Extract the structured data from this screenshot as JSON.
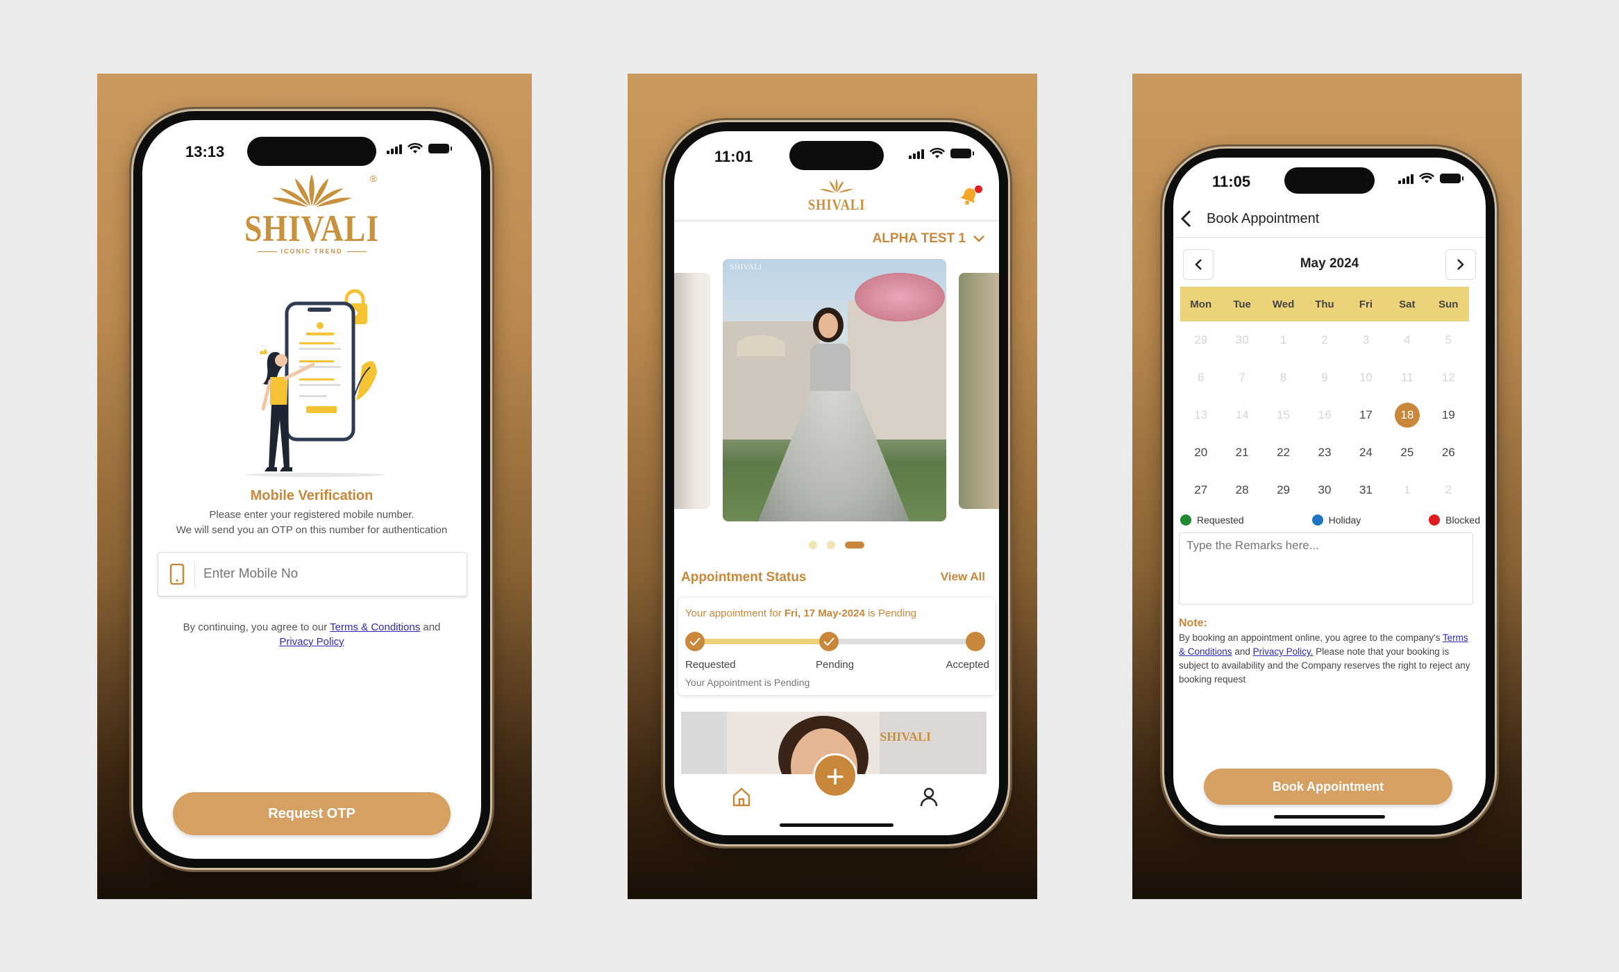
{
  "login": {
    "status_time": "13:13",
    "brand_name": "SHIVALI",
    "brand_tagline": "ICONIC TREND",
    "brand_registered": "®",
    "heading": "Mobile Verification",
    "subtitle_line1": "Please enter your registered mobile number.",
    "subtitle_line2": "We will send you an OTP on this number for authentication",
    "mobile_placeholder": "Enter Mobile No",
    "consent_prefix": "By continuing, you agree to our",
    "terms_link": "Terms & Conditions",
    "consent_and": "and",
    "privacy_link": "Privacy Policy",
    "request_button": "Request OTP"
  },
  "home": {
    "status_time": "11:01",
    "brand_name": "SHIVALI",
    "store_selector": "ALPHA TEST 1",
    "carousel_watermark": "SHIVALI",
    "carousel_total": 3,
    "carousel_active": 3,
    "appointment_heading": "Appointment Status",
    "view_all": "View All",
    "appointment_prefix": "Your appointment for",
    "appointment_date": "Fri, 17 May-2024",
    "appointment_suffix": "is Pending",
    "steps": [
      "Requested",
      "Pending",
      "Accepted"
    ],
    "status_note": "Your Appointment is Pending",
    "banner_watermark": "SHIVALI",
    "nav_add": "+"
  },
  "booking": {
    "status_time": "11:05",
    "title": "Book Appointment",
    "month": "May 2024",
    "weekdays": [
      "Mon",
      "Tue",
      "Wed",
      "Thu",
      "Fri",
      "Sat",
      "Sun"
    ],
    "days": [
      [
        "29",
        "30",
        "1",
        "2",
        "3",
        "4",
        "5"
      ],
      [
        "6",
        "7",
        "8",
        "9",
        "10",
        "11",
        "12"
      ],
      [
        "13",
        "14",
        "15",
        "16",
        "17",
        "18",
        "19"
      ],
      [
        "20",
        "21",
        "22",
        "23",
        "24",
        "25",
        "26"
      ],
      [
        "27",
        "28",
        "29",
        "30",
        "31",
        "1",
        "2"
      ]
    ],
    "selected_day": "18",
    "first_enabled_day": "17",
    "legend": [
      {
        "label": "Requested",
        "color": "#1f8a2e"
      },
      {
        "label": "Holiday",
        "color": "#1f74c4"
      },
      {
        "label": "Blocked",
        "color": "#e01b1b"
      }
    ],
    "remarks_placeholder": "Type the Remarks here...",
    "note_title": "Note:",
    "note_text_1": "By booking an appointment online, you agree to the company's",
    "terms_link": "Terms & Conditions",
    "note_and": "and",
    "privacy_link": "Privacy Policy.",
    "note_text_2": "Please note that your booking is subject to availability and the Company reserves the right to reject any booking request",
    "book_button": "Book Appointment"
  },
  "colors": {
    "accent": "#c8873a",
    "button": "#d6a062",
    "calendar_header": "#ecd37a"
  }
}
